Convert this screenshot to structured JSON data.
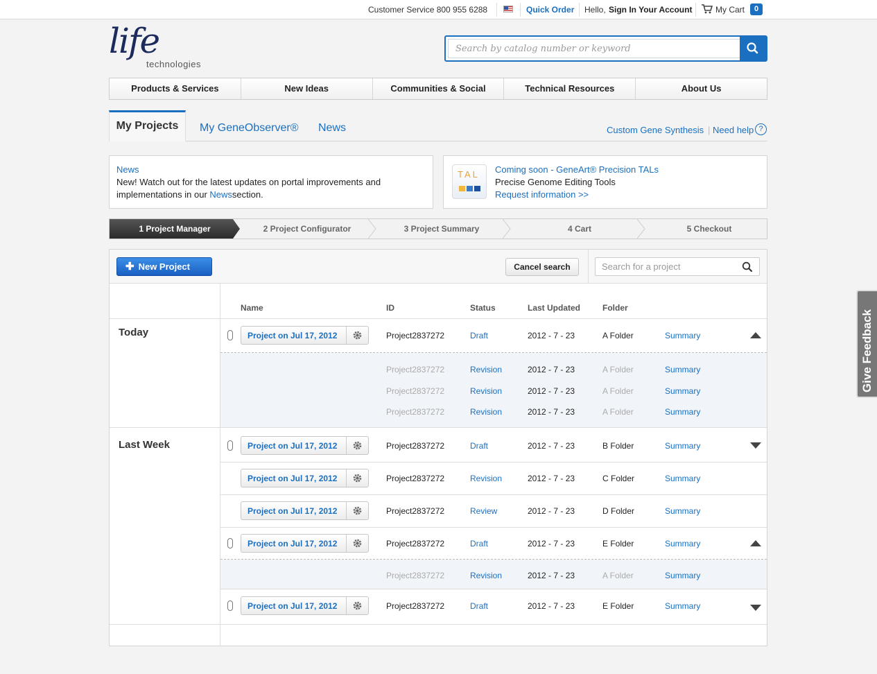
{
  "topbar": {
    "customer_service": "Customer Service 800 955 6288",
    "quick_order": "Quick Order",
    "hello": "Hello,",
    "sign_in": "Sign In Your Account",
    "my_cart": "My Cart",
    "cart_count": "0"
  },
  "header": {
    "logo_script": "life",
    "logo_sub": "technologies",
    "search_placeholder": "Search by catalog number or keyword"
  },
  "nav": [
    "Products & Services",
    "New Ideas",
    "Communities & Social",
    "Technical Resources",
    "About Us"
  ],
  "tabs": {
    "active": "My Projects",
    "gene": "My GeneObserver®",
    "news": "News",
    "custom": "Custom Gene Synthesis",
    "help": "Need help",
    "help_mark": "?"
  },
  "news_box": {
    "title": "News",
    "text1": "New! Watch out for the latest updates on portal improvements and",
    "text2a": "implementations in our ",
    "text2_link": "News",
    "text2b": "section."
  },
  "promo_box": {
    "icon_text": "TAL",
    "title": "Coming soon - GeneArt® Precision TALs",
    "subtitle": "Precise Genome Editing Tools",
    "link": "Request information >>"
  },
  "steps": [
    "1  Project Manager",
    "2  Project Configurator",
    "3  Project Summary",
    "4  Cart",
    "5  Checkout"
  ],
  "toolbar": {
    "new_project": "New Project",
    "cancel_search": "Cancel search",
    "search_placeholder": "Search for a project"
  },
  "columns": {
    "name": "Name",
    "id": "ID",
    "status": "Status",
    "updated": "Last Updated",
    "folder": "Folder"
  },
  "groups": {
    "today": "Today",
    "last_week": "Last Week"
  },
  "rows": [
    {
      "name": "Project on Jul 17, 2012",
      "id": "Project2837272",
      "status": "Draft",
      "updated": "2012 - 7 - 23",
      "folder": "A Folder",
      "summary": "Summary"
    },
    {
      "id": "Project2837272",
      "status": "Revision",
      "updated": "2012 - 7 - 23",
      "folder": "A Folder",
      "summary": "Summary"
    },
    {
      "id": "Project2837272",
      "status": "Revision",
      "updated": "2012 - 7 - 23",
      "folder": "A Folder",
      "summary": "Summary"
    },
    {
      "id": "Project2837272",
      "status": "Revision",
      "updated": "2012 - 7 - 23",
      "folder": "A Folder",
      "summary": "Summary"
    },
    {
      "name": "Project on Jul 17, 2012",
      "id": "Project2837272",
      "status": "Draft",
      "updated": "2012 - 7 - 23",
      "folder": "B Folder",
      "summary": "Summary"
    },
    {
      "name": "Project on Jul 17, 2012",
      "id": "Project2837272",
      "status": "Revision",
      "updated": "2012 - 7 - 23",
      "folder": "C Folder",
      "summary": "Summary"
    },
    {
      "name": "Project on Jul 17, 2012",
      "id": "Project2837272",
      "status": "Review",
      "updated": "2012 - 7 - 23",
      "folder": "D Folder",
      "summary": "Summary"
    },
    {
      "name": "Project on Jul 17, 2012",
      "id": "Project2837272",
      "status": "Draft",
      "updated": "2012 - 7 - 23",
      "folder": "E Folder",
      "summary": "Summary"
    },
    {
      "id": "Project2837272",
      "status": "Revision",
      "updated": "2012 - 7 - 23",
      "folder": "A Folder",
      "summary": "Summary"
    },
    {
      "name": "Project on Jul 17, 2012",
      "id": "Project2837272",
      "status": "Draft",
      "updated": "2012 - 7 - 23",
      "folder": "E Folder",
      "summary": "Summary"
    }
  ],
  "feedback": "Give Feedback",
  "colors": {
    "accent": "#1a6fc0",
    "logo": "#1c2a5c",
    "step_active": "#333333"
  },
  "icons": [
    "flag-icon",
    "cart-icon",
    "search-icon",
    "plus-icon",
    "paperclip-icon",
    "gear-icon",
    "collapse-arrow-icon",
    "expand-arrow-icon"
  ]
}
